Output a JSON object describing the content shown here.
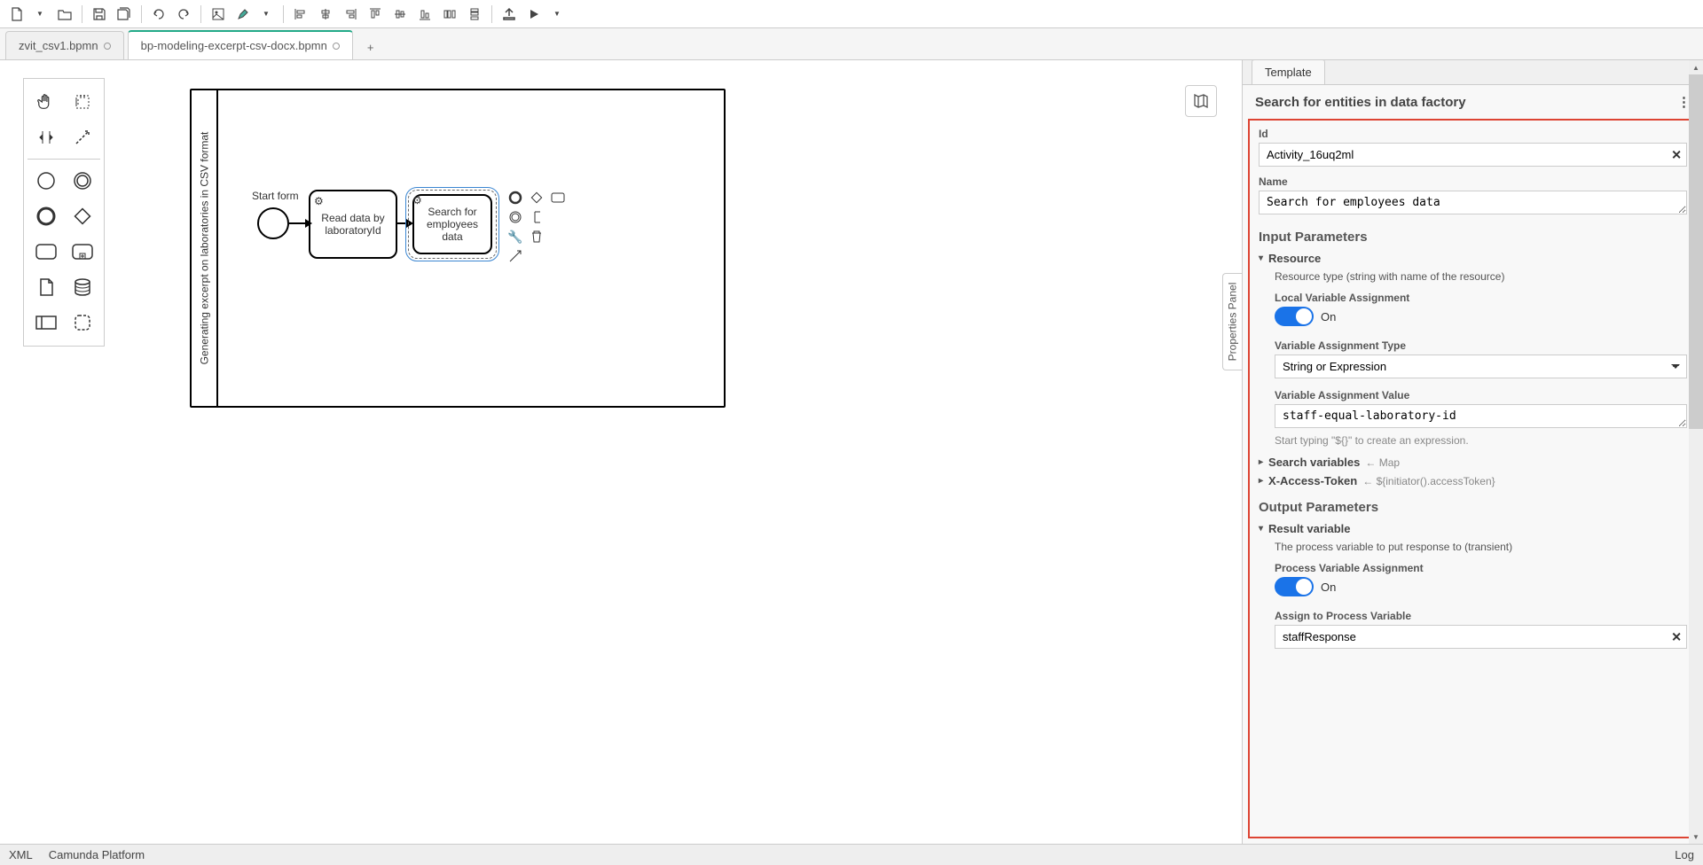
{
  "tabs": {
    "tab1": "zvit_csv1.bpmn",
    "tab2": "bp-modeling-excerpt-csv-docx.bpmn"
  },
  "diagram": {
    "pool_label": "Generating excerpt on laboratories in CSV format",
    "start_label": "Start form",
    "task1": "Read data by laboratoryId",
    "task2": "Search for employees data"
  },
  "prop_collapse_label": "Properties Panel",
  "properties": {
    "tab_template": "Template",
    "title": "Search for entities in data factory",
    "id_label": "Id",
    "id_value": "Activity_16uq2ml",
    "name_label": "Name",
    "name_value": "Search for employees data",
    "input_params_title": "Input Parameters",
    "resource_label": "Resource",
    "resource_desc": "Resource type (string with name of the resource)",
    "local_var_label": "Local Variable Assignment",
    "on_label": "On",
    "var_type_label": "Variable Assignment Type",
    "var_type_value": "String or Expression",
    "var_value_label": "Variable Assignment Value",
    "var_value": "staff-equal-laboratory-id",
    "var_value_hint": "Start typing \"${}\" to create an expression.",
    "search_vars_label": "Search variables",
    "search_vars_meta": "Map",
    "xaccess_label": "X-Access-Token",
    "xaccess_meta": "${initiator().accessToken}",
    "output_params_title": "Output Parameters",
    "result_var_label": "Result variable",
    "result_var_desc": "The process variable to put response to (transient)",
    "proc_var_label": "Process Variable Assignment",
    "assign_proc_label": "Assign to Process Variable",
    "assign_proc_value": "staffResponse"
  },
  "statusbar": {
    "xml": "XML",
    "platform": "Camunda Platform",
    "log": "Log"
  }
}
